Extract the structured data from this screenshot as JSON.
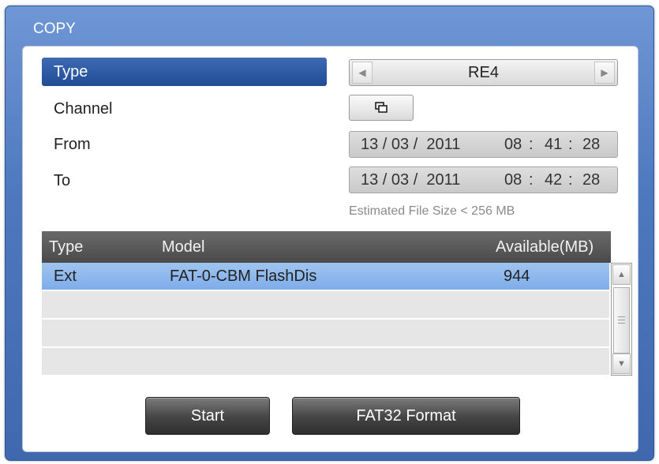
{
  "dialog": {
    "title": "COPY"
  },
  "form": {
    "type_label": "Type",
    "type_value": "RE4",
    "channel_label": "Channel",
    "from_label": "From",
    "from": {
      "date": "13 / 03 /  2011",
      "hh": "08",
      "mm": "41",
      "ss": "28"
    },
    "to_label": "To",
    "to": {
      "date": "13 / 03 /  2011",
      "hh": "08",
      "mm": "42",
      "ss": "28"
    },
    "estimate": "Estimated File Size < 256 MB"
  },
  "table": {
    "headers": {
      "type": "Type",
      "model": "Model",
      "available": "Available(MB)"
    },
    "rows": [
      {
        "type": "Ext",
        "model": "FAT-0-CBM FlashDis",
        "available": "944"
      }
    ]
  },
  "buttons": {
    "start": "Start",
    "format": "FAT32 Format"
  },
  "icons": {
    "spin_left": "left-arrow-icon",
    "spin_right": "right-arrow-icon",
    "channel": "channel-select-icon",
    "scroll_up": "scroll-up-icon",
    "scroll_down": "scroll-down-icon"
  },
  "colors": {
    "dialog_blue": "#4f79bf",
    "selection_blue": "#204c96",
    "row_highlight": "#8cb7ec",
    "header_gray": "#555555"
  }
}
